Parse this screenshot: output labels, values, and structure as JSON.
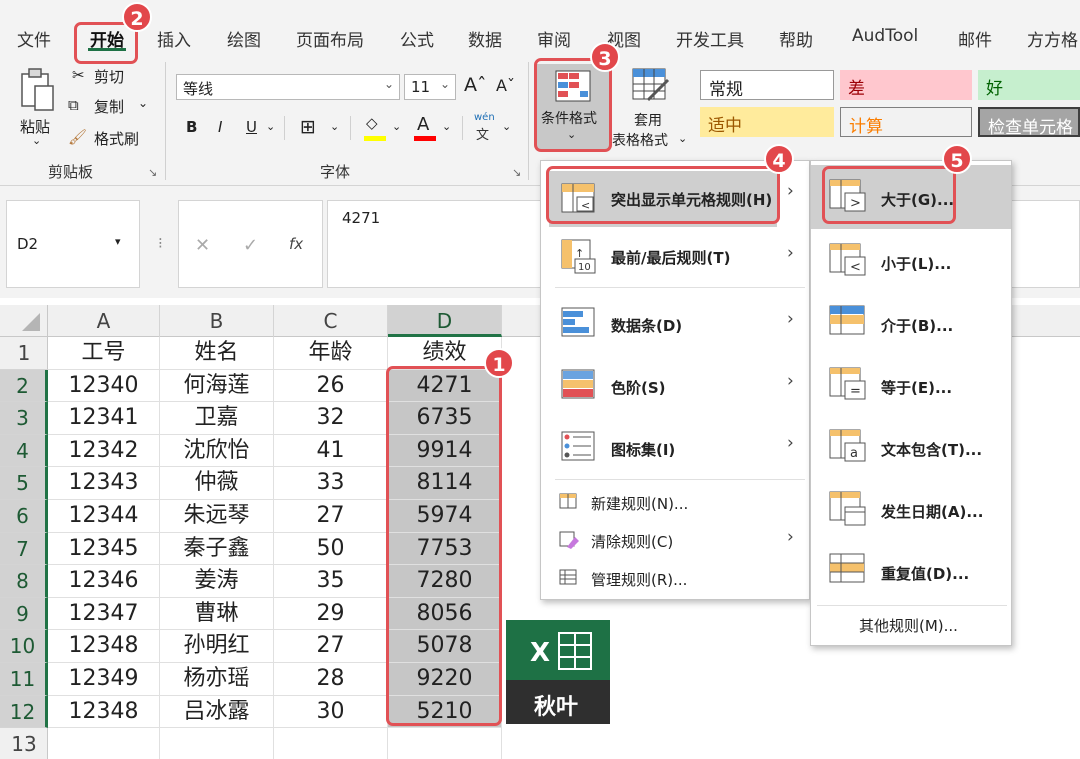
{
  "ribbon_tabs": [
    "文件",
    "开始",
    "插入",
    "绘图",
    "页面布局",
    "公式",
    "数据",
    "审阅",
    "视图",
    "开发工具",
    "帮助",
    "AudTool",
    "邮件",
    "方方格"
  ],
  "clipboard": {
    "paste": "粘贴",
    "cut": "剪切",
    "copy": "复制",
    "format_painter": "格式刷",
    "group": "剪贴板"
  },
  "font": {
    "name": "等线",
    "size": "11",
    "bold": "B",
    "italic": "I",
    "underline": "U",
    "font_color": "A",
    "phonetic": "wén",
    "group": "字体"
  },
  "styles_group": {
    "conditional_format": "条件格式",
    "table_format_line1": "套用",
    "table_format_line2": "表格格式"
  },
  "cell_styles": {
    "normal": "常规",
    "bad": "差",
    "good": "好",
    "neutral": "适中",
    "calculation": "计算",
    "check_cell": "检查单元格"
  },
  "formula_bar": {
    "name_box": "D2",
    "fx": "fx",
    "value": "4271"
  },
  "sheet": {
    "columns": [
      "A",
      "B",
      "C",
      "D"
    ],
    "row_numbers": [
      "1",
      "2",
      "3",
      "4",
      "5",
      "6",
      "7",
      "8",
      "9",
      "10",
      "11",
      "12",
      "13"
    ],
    "header": [
      "工号",
      "姓名",
      "年龄",
      "绩效"
    ],
    "rows": [
      [
        "12340",
        "何海莲",
        "26",
        "4271"
      ],
      [
        "12341",
        "卫嘉",
        "32",
        "6735"
      ],
      [
        "12342",
        "沈欣怡",
        "41",
        "9914"
      ],
      [
        "12343",
        "仲薇",
        "33",
        "8114"
      ],
      [
        "12344",
        "朱远琴",
        "27",
        "5974"
      ],
      [
        "12345",
        "秦子鑫",
        "50",
        "7753"
      ],
      [
        "12346",
        "姜涛",
        "35",
        "7280"
      ],
      [
        "12347",
        "曹琳",
        "29",
        "8056"
      ],
      [
        "12348",
        "孙明红",
        "27",
        "5078"
      ],
      [
        "12349",
        "杨亦瑶",
        "28",
        "9220"
      ],
      [
        "12348",
        "吕冰露",
        "30",
        "5210"
      ]
    ]
  },
  "cf_menu": {
    "highlight": "突出显示单元格规则(H)",
    "topbottom": "最前/最后规则(T)",
    "databar": "数据条(D)",
    "colorscale": "色阶(S)",
    "iconset": "图标集(I)",
    "newrule": "新建规则(N)...",
    "clearrules": "清除规则(C)",
    "managerules": "管理规则(R)..."
  },
  "sub_menu": {
    "greater": "大于(G)...",
    "less": "小于(L)...",
    "between": "介于(B)...",
    "equal": "等于(E)...",
    "textcontains": "文本包含(T)...",
    "dateoccurring": "发生日期(A)...",
    "duplicate": "重复值(D)...",
    "morerules": "其他规则(M)..."
  },
  "watermark": {
    "letter": "X",
    "text": "秋叶"
  },
  "badges": [
    "1",
    "2",
    "3",
    "4",
    "5"
  ],
  "colors": {
    "accent_green": "#217346",
    "annotation_red": "#e2474b",
    "selection_gray": "#c6c6c6"
  }
}
